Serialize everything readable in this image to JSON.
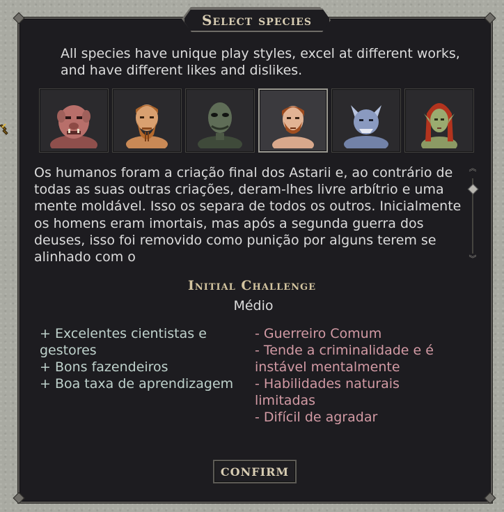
{
  "dialog": {
    "title": "Select species",
    "intro": "All species have unique play styles, excel at different works, and have different likes and dislikes."
  },
  "species": [
    {
      "name": "orc-portrait",
      "selected": false
    },
    {
      "name": "dwarf-portrait",
      "selected": false
    },
    {
      "name": "reptilian-portrait",
      "selected": false
    },
    {
      "name": "human-portrait",
      "selected": true
    },
    {
      "name": "beast-portrait",
      "selected": false
    },
    {
      "name": "elf-portrait",
      "selected": false
    }
  ],
  "description": "Os humanos foram a criação final dos Astarii e, ao contrário de todas as suas outras criações, deram-lhes livre arbítrio e uma mente moldável. Isso os separa de todos os outros. Inicialmente os homens eram imortais, mas após a segunda guerra dos deuses, isso foi removido como punição por alguns terem se alinhado com o",
  "challenge": {
    "heading": "Initial Challenge",
    "value": "Médio"
  },
  "pros": [
    "+ Excelentes cientistas e gestores",
    "+ Bons fazendeiros",
    "+ Boa taxa de aprendizagem"
  ],
  "cons": [
    "- Guerreiro Comum",
    "- Tende a criminalidade e é instável mentalmente",
    "- Habilidades naturais limitadas",
    "- Difícil de agradar"
  ],
  "confirm_label": "CONFIRM",
  "colors": {
    "panel": "#1d1c20",
    "pros": "#bfd2cc",
    "cons": "#d29aa4",
    "gold": "#d3c49f"
  }
}
